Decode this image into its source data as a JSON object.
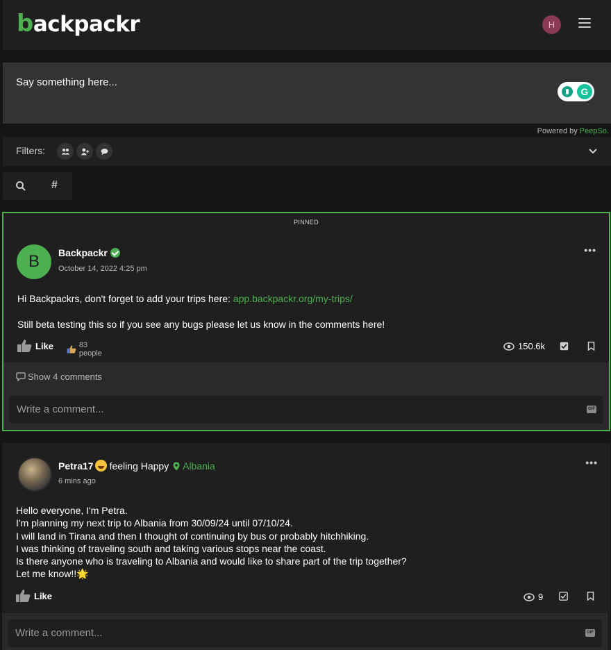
{
  "app": {
    "logo_initial": "b",
    "logo_rest": "ackpackr",
    "user_initial": "H"
  },
  "composer": {
    "placeholder": "Say something here...",
    "grammarly_letter": "G"
  },
  "powered": {
    "prefix": "Powered by",
    "brand": "PeepSo."
  },
  "filters": {
    "label": "Filters:"
  },
  "search": {
    "hash": "#"
  },
  "colors": {
    "accent": "#4caf50",
    "background": "#151515",
    "panel": "#1f1f1f"
  },
  "posts": [
    {
      "pinned_label": "PINNED",
      "avatar_initial": "B",
      "author": "Backpackr",
      "timestamp": "October 14, 2022 4:25 pm",
      "text_line1": "Hi Backpackrs, don't forget to add your trips here:",
      "link": "app.backpackr.org/my-trips/",
      "text_line2": "Still beta testing this so if you see any bugs please let us know in the comments here!",
      "like_label": "Like",
      "likes_people": "83 people",
      "views": "150.6k",
      "show_comments": "Show 4 comments",
      "comment_placeholder": "Write a comment...",
      "gif": "GIF"
    },
    {
      "author": "Petra17",
      "feeling": "feeling Happy",
      "location": "Albania",
      "timestamp": "6 mins ago",
      "lines": [
        "Hello everyone, I'm Petra.",
        "I'm planning my next trip to Albania from 30/09/24 until 07/10/24.",
        "I will land in Tirana and then I thought of continuing by bus or probably hitchhiking.",
        "I was thinking of traveling south and taking various stops near the coast.",
        "Is there anyone who is traveling to Albania and would like to share part of the trip together?",
        "Let me know!!🌟"
      ],
      "like_label": "Like",
      "views": "9",
      "comment_placeholder": "Write a comment...",
      "gif": "GIF"
    }
  ]
}
